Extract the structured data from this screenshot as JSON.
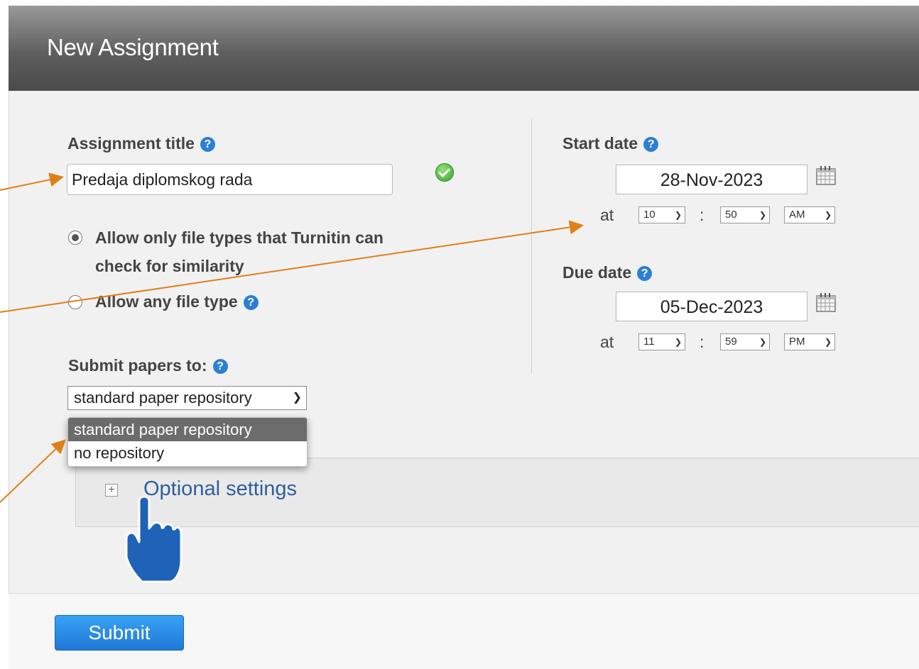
{
  "header": {
    "title": "New Assignment"
  },
  "title_field": {
    "label": "Assignment title",
    "value": "Predaja diplomskog rada"
  },
  "file_types": {
    "option1_line1": "Allow only file types that Turnitin can",
    "option1_line2": "check for similarity",
    "option2": "Allow any file type",
    "selected": "option1"
  },
  "submit_to": {
    "label": "Submit papers to:",
    "selected": "standard paper repository",
    "options": [
      "standard paper repository",
      "no repository"
    ]
  },
  "start_date": {
    "label": "Start date",
    "date": "28-Nov-2023",
    "at": "at",
    "hour": "10",
    "minute": "50",
    "ampm": "AM"
  },
  "due_date": {
    "label": "Due date",
    "date": "05-Dec-2023",
    "at": "at",
    "hour": "11",
    "minute": "59",
    "ampm": "PM"
  },
  "optional_settings": {
    "label": "Optional settings"
  },
  "buttons": {
    "submit": "Submit"
  },
  "colors": {
    "accent": "#2b7fd4",
    "annotation_arrow": "#e07f16",
    "pointer_hand": "#1f63b8"
  },
  "icons": {
    "help": "help-icon",
    "valid": "check-icon",
    "calendar": "calendar-icon",
    "expand": "plus-icon",
    "pointer": "hand-pointer-icon"
  }
}
